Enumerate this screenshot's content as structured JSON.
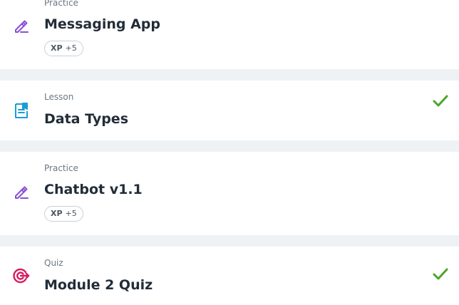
{
  "colors": {
    "practice_icon": "#8a4fd6",
    "lesson_icon": "#1c9cd8",
    "quiz_icon": "#d81b60",
    "check": "#4aa629",
    "background": "#eff2f5",
    "card": "#ffffff"
  },
  "items": [
    {
      "type": "Practice",
      "title": "Messaging App",
      "icon": "pencil-icon",
      "badge": {
        "label": "XP",
        "value": "+5"
      },
      "completed": false
    },
    {
      "type": "Lesson",
      "title": "Data Types",
      "icon": "document-icon",
      "completed": true
    },
    {
      "type": "Practice",
      "title": "Chatbot v1.1",
      "icon": "pencil-icon",
      "badge": {
        "label": "XP",
        "value": "+5"
      },
      "completed": false
    },
    {
      "type": "Quiz",
      "title": "Module 2 Quiz",
      "icon": "target-icon",
      "completed": true
    }
  ]
}
